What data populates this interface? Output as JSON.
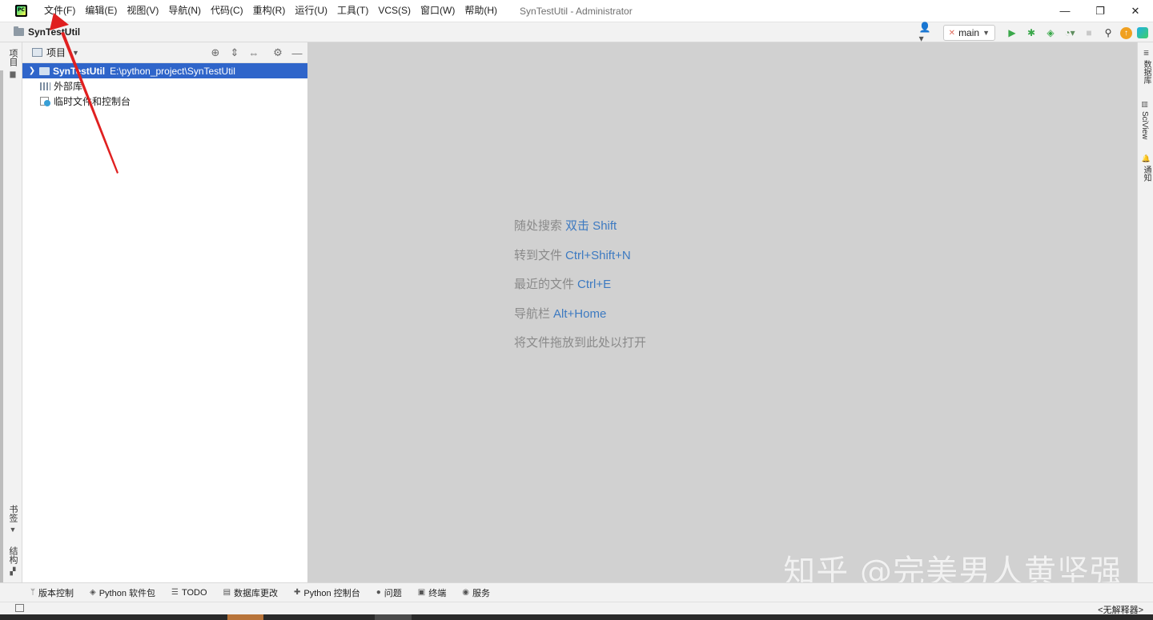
{
  "window": {
    "title": "SynTestUtil - Administrator",
    "minimize": "—",
    "restore": "❐",
    "close": "✕"
  },
  "menu": [
    {
      "label": "文件(F)"
    },
    {
      "label": "编辑(E)"
    },
    {
      "label": "视图(V)"
    },
    {
      "label": "导航(N)"
    },
    {
      "label": "代码(C)"
    },
    {
      "label": "重构(R)"
    },
    {
      "label": "运行(U)"
    },
    {
      "label": "工具(T)"
    },
    {
      "label": "VCS(S)"
    },
    {
      "label": "窗口(W)"
    },
    {
      "label": "帮助(H)"
    }
  ],
  "navbar": {
    "project": "SynTestUtil",
    "branch": "main"
  },
  "left_strip": {
    "project_tab": "项目",
    "bookmarks_tab": "书签",
    "structure_tab": "结构"
  },
  "project_panel": {
    "title": "项目",
    "tree": {
      "root_name": "SynTestUtil",
      "root_path": "E:\\python_project\\SynTestUtil",
      "external_libs": "外部库",
      "scratches": "临时文件和控制台"
    }
  },
  "editor_hints": [
    {
      "text": "随处搜索",
      "key": "双击 Shift"
    },
    {
      "text": "转到文件",
      "key": "Ctrl+Shift+N"
    },
    {
      "text": "最近的文件",
      "key": "Ctrl+E"
    },
    {
      "text": "导航栏",
      "key": "Alt+Home"
    },
    {
      "text": "将文件拖放到此处以打开",
      "key": ""
    }
  ],
  "right_strip": {
    "database_tab": "数据库",
    "sciview_tab": "SciView",
    "notifications_tab": "通知"
  },
  "bottom_tools": [
    {
      "icon": "vcs-icon",
      "glyph": "ᛘ",
      "label": "版本控制"
    },
    {
      "icon": "python-packages-icon",
      "glyph": "◈",
      "label": "Python 软件包"
    },
    {
      "icon": "todo-icon",
      "glyph": "☰",
      "label": "TODO"
    },
    {
      "icon": "db-changes-icon",
      "glyph": "▤",
      "label": "数据库更改"
    },
    {
      "icon": "python-console-icon",
      "glyph": "✚",
      "label": "Python 控制台"
    },
    {
      "icon": "problems-icon",
      "glyph": "●",
      "label": "问题"
    },
    {
      "icon": "terminal-icon",
      "glyph": "▣",
      "label": "终端"
    },
    {
      "icon": "services-icon",
      "glyph": "◉",
      "label": "服务"
    }
  ],
  "statusbar": {
    "interpreter": "<无解释器>"
  },
  "watermark": "知乎 @完美男人黄坚强",
  "colors": {
    "selection": "#2f65ca",
    "hint_key": "#3d7ac1",
    "annotation_arrow": "#e02020"
  }
}
